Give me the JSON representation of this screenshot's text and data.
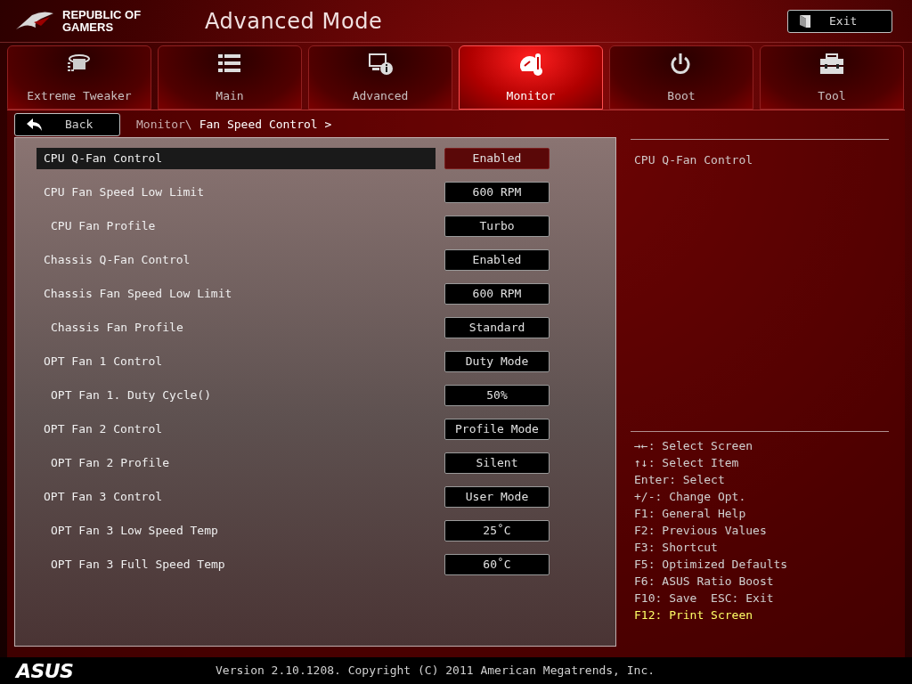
{
  "header": {
    "brand": [
      "REPUBLIC OF",
      "GAMERS"
    ],
    "title": "Advanced Mode",
    "exit_button": "Exit"
  },
  "tabs": [
    {
      "label": "Extreme Tweaker",
      "kind": "tweaker",
      "selected": false
    },
    {
      "label": "Main",
      "kind": "list",
      "selected": false
    },
    {
      "label": "Advanced",
      "kind": "advanced",
      "selected": false
    },
    {
      "label": "Monitor",
      "kind": "monitor",
      "selected": true
    },
    {
      "label": "Boot",
      "kind": "power",
      "selected": false
    },
    {
      "label": "Tool",
      "kind": "toolbox",
      "selected": false
    }
  ],
  "breadcrumb": {
    "back_button": "Back",
    "path": "Monitor\\",
    "current": "Fan Speed Control >"
  },
  "settings": [
    {
      "label": "CPU Q-Fan Control",
      "value": "Enabled",
      "selected": true
    },
    {
      "label": "CPU Fan Speed Low Limit",
      "value": "600 RPM",
      "selected": false,
      "children": [
        {
          "label": "CPU Fan Profile",
          "value": "Turbo",
          "selected": false
        }
      ]
    },
    {
      "label": "Chassis Q-Fan Control",
      "value": "Enabled",
      "selected": false
    },
    {
      "label": "Chassis Fan Speed Low Limit",
      "value": "600 RPM",
      "selected": false,
      "children": [
        {
          "label": "Chassis Fan Profile",
          "value": "Standard",
          "selected": false
        }
      ]
    },
    {
      "label": "OPT Fan 1 Control",
      "value": "Duty Mode",
      "selected": false,
      "children": [
        {
          "label": "OPT Fan 1. Duty Cycle()",
          "value": "50%",
          "selected": false
        }
      ]
    },
    {
      "label": "OPT Fan 2 Control",
      "value": "Profile Mode",
      "selected": false,
      "children": [
        {
          "label": "OPT Fan 2 Profile",
          "value": "Silent",
          "selected": false
        }
      ]
    },
    {
      "label": "OPT Fan 3 Control",
      "value": "User Mode",
      "selected": false,
      "children": [
        {
          "label": "OPT Fan 3 Low Speed Temp",
          "value": "25˚C",
          "selected": false
        },
        {
          "label": "OPT Fan 3 Full Speed Temp",
          "value": "60˚C",
          "selected": false
        }
      ]
    }
  ],
  "help": {
    "description": "CPU Q-Fan Control",
    "keys": [
      {
        "text": "→←: Select Screen",
        "color": "#d0d0d0"
      },
      {
        "text": "↑↓: Select Item",
        "color": "#d0d0d0"
      },
      {
        "text": "Enter: Select",
        "color": "#d0d0d0"
      },
      {
        "text": "+/-: Change Opt.",
        "color": "#d0d0d0"
      },
      {
        "text": "F1: General Help",
        "color": "#d0d0d0"
      },
      {
        "text": "F2: Previous Values",
        "color": "#d0d0d0"
      },
      {
        "text": "F3: Shortcut",
        "color": "#d0d0d0"
      },
      {
        "text": "F5: Optimized Defaults",
        "color": "#d0d0d0"
      },
      {
        "text": "F6: ASUS Ratio Boost",
        "color": "#d0d0d0"
      },
      {
        "text": "F10: Save  ESC: Exit",
        "color": "#d0d0d0"
      },
      {
        "text": "F12: Print Screen",
        "color": "#ffff66"
      }
    ]
  },
  "footer": {
    "logo": "ASUS",
    "version": "Version 2.10.1208. Copyright (C) 2011 American Megatrends, Inc."
  }
}
